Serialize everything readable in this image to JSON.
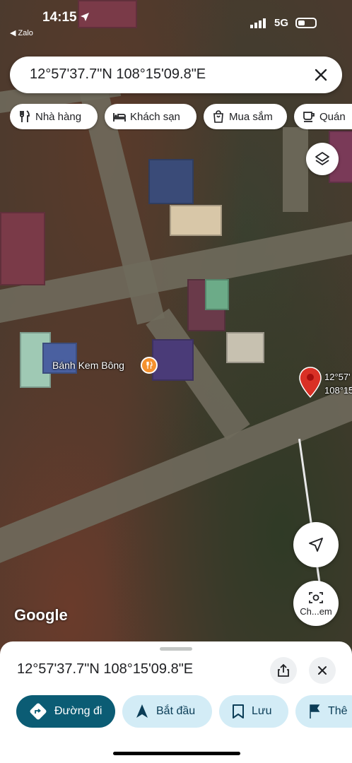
{
  "status_bar": {
    "time": "14:15",
    "back_app": "◀ Zalo",
    "network": "5G"
  },
  "search": {
    "query": "12°57'37.7\"N 108°15'09.8\"E"
  },
  "chips": [
    {
      "label": "Nhà hàng",
      "icon": "restaurant-icon"
    },
    {
      "label": "Khách sạn",
      "icon": "hotel-icon"
    },
    {
      "label": "Mua sắm",
      "icon": "shopping-bag-icon"
    },
    {
      "label": "Quán",
      "icon": "coffee-icon"
    }
  ],
  "map": {
    "place_name": "Bánh Kem Bông",
    "pin_label_line1": "12°57'",
    "pin_label_line2": "108°15'",
    "camera_button_label": "Ch...em",
    "attribution": "Google"
  },
  "sheet": {
    "title": "12°57'37.7\"N 108°15'09.8\"E",
    "actions": [
      {
        "label": "Đường đi",
        "icon": "directions-icon"
      },
      {
        "label": "Bắt đầu",
        "icon": "navigation-arrow-icon"
      },
      {
        "label": "Lưu",
        "icon": "bookmark-icon"
      },
      {
        "label": "Thê",
        "icon": "flag-icon"
      }
    ]
  },
  "colors": {
    "primary": "#0b5c74",
    "secondary": "#d3ecf6",
    "pin": "#d93025",
    "food": "#f4912e"
  }
}
